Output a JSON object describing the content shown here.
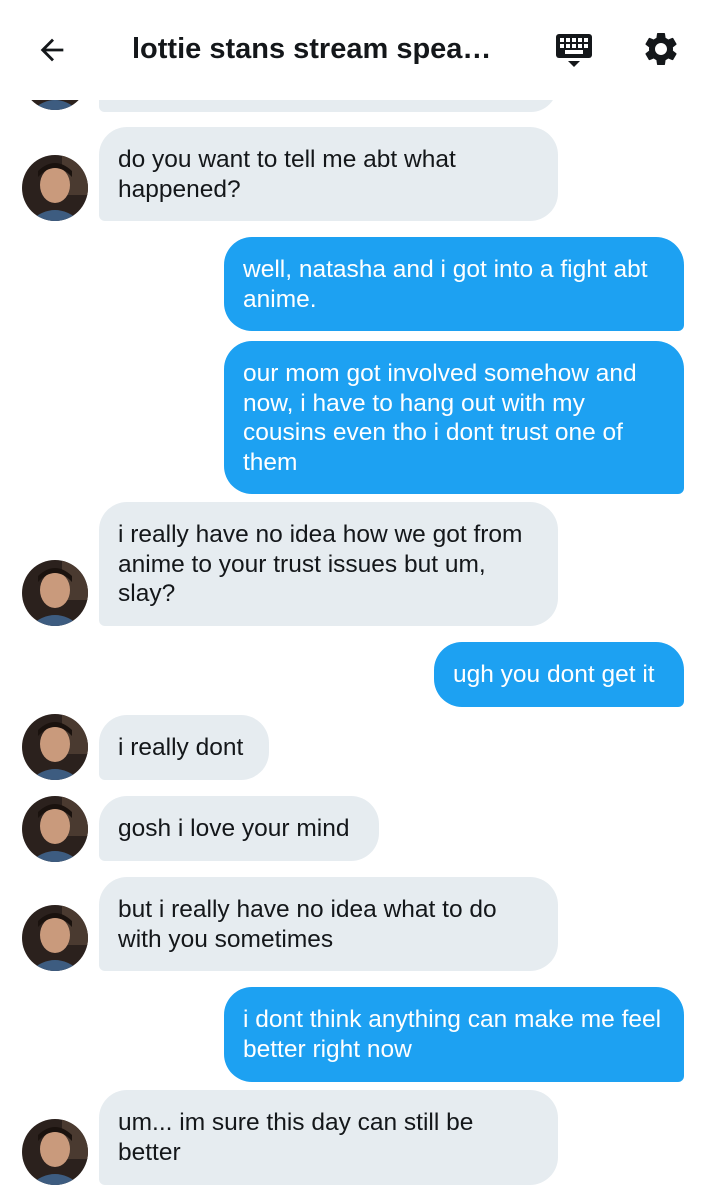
{
  "header": {
    "title": "lottie stans stream speak ..."
  },
  "colors": {
    "outgoing_bubble": "#1da1f2",
    "incoming_bubble": "#e6ecf0",
    "text_dark": "#14171a"
  },
  "icons": {
    "back": "arrow-left-icon",
    "keyboard": "keyboard-icon",
    "settings": "gear-icon"
  },
  "messages": [
    {
      "direction": "in",
      "text": "do you want to tell me abt what happened?"
    },
    {
      "direction": "out",
      "text": "well, natasha and i got into a fight abt anime."
    },
    {
      "direction": "out",
      "text": "our mom got involved somehow and now, i have to hang out with my cousins even tho i dont trust one of them"
    },
    {
      "direction": "in",
      "text": "i really have no idea how we got from anime to your trust issues but um, slay?"
    },
    {
      "direction": "out",
      "text": "ugh you dont get it"
    },
    {
      "direction": "in",
      "text": "i really dont"
    },
    {
      "direction": "in",
      "text": "gosh i love your mind"
    },
    {
      "direction": "in",
      "text": "but i really have no idea what to do with you sometimes"
    },
    {
      "direction": "out",
      "text": "i dont think anything can make me feel better right now"
    },
    {
      "direction": "in",
      "text": "um... im sure this day can still be better"
    }
  ]
}
